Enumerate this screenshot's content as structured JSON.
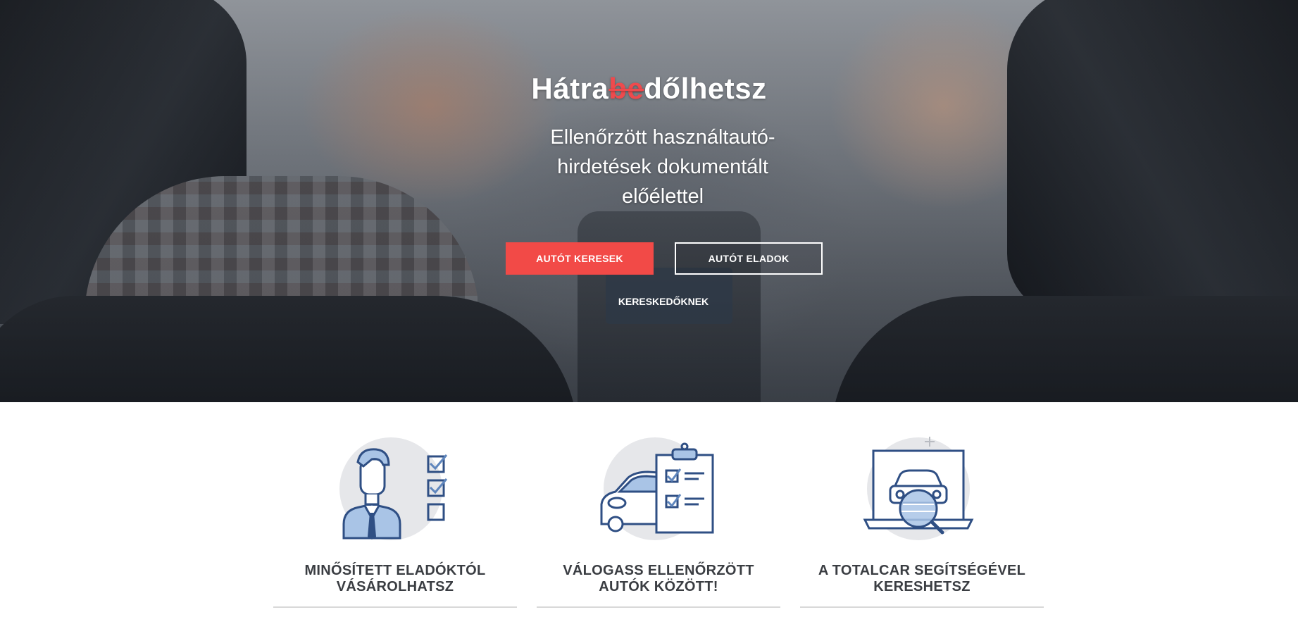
{
  "hero": {
    "title_part1": "Hátra",
    "title_strike": "be",
    "title_part2": "dőlhetsz",
    "subtitle": "Ellenőrzött használtautó-hirdetések dokumentált előélettel",
    "primary_button": "AUTÓT KERESEK",
    "secondary_button": "AUTÓT ELADOK",
    "dealers_link": "KERESKEDŐKNEK"
  },
  "features": [
    {
      "icon": "certified-seller-icon",
      "title": "MINŐSÍTETT ELADÓKTÓL VÁSÁROLHATSZ"
    },
    {
      "icon": "car-checklist-icon",
      "title": "VÁLOGASS ELLENŐRZÖTT AUTÓK KÖZÖTT!"
    },
    {
      "icon": "laptop-search-car-icon",
      "title": "A TOTALCAR SEGÍTSÉGÉVEL KERESHETSZ"
    }
  ],
  "colors": {
    "accent_red": "#f24a47",
    "icon_blue": "#2f4f84",
    "icon_light_blue": "#a9c4e6",
    "icon_circle": "#e6e7ea",
    "feature_text": "#3a3d42"
  }
}
